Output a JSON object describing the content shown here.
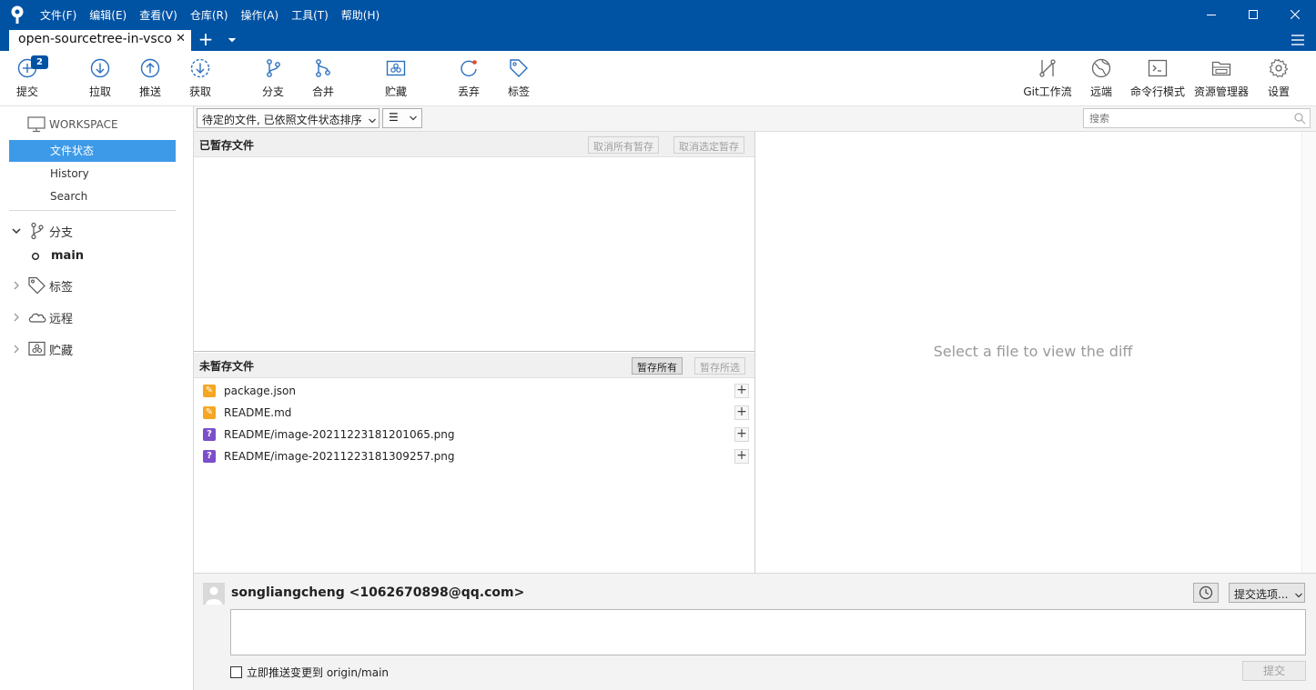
{
  "menu": [
    "文件(F)",
    "编辑(E)",
    "查看(V)",
    "仓库(R)",
    "操作(A)",
    "工具(T)",
    "帮助(H)"
  ],
  "tab": {
    "title": "open-sourcetree-in-vsco...",
    "close": "✕",
    "add": "+"
  },
  "toolbar": {
    "badge": "2",
    "commit": "提交",
    "pull": "拉取",
    "push": "推送",
    "fetch": "获取",
    "branch": "分支",
    "merge": "合并",
    "stash": "贮藏",
    "discard": "丢弃",
    "tag": "标签",
    "gitflow": "Git工作流",
    "remote": "远端",
    "terminal": "命令行模式",
    "explorer": "资源管理器",
    "settings": "设置"
  },
  "sidebar": {
    "workspace": "WORKSPACE",
    "items": [
      "文件状态",
      "History",
      "Search"
    ],
    "branches": "分支",
    "current_branch": "main",
    "tags": "标签",
    "remotes": "远程",
    "stashes": "贮藏"
  },
  "filter": {
    "sort": "待定的文件, 已依照文件状态排序",
    "view": "☰",
    "search_placeholder": "搜索"
  },
  "staged": {
    "title": "已暂存文件",
    "unstage_all": "取消所有暂存",
    "unstage_selected": "取消选定暂存"
  },
  "unstaged": {
    "title": "未暂存文件",
    "stage_all": "暂存所有",
    "stage_selected": "暂存所选",
    "files": [
      {
        "name": "package.json",
        "status": "modified"
      },
      {
        "name": "README.md",
        "status": "modified"
      },
      {
        "name": "README/image-20211223181201065.png",
        "status": "untracked"
      },
      {
        "name": "README/image-20211223181309257.png",
        "status": "untracked"
      }
    ]
  },
  "diff": {
    "placeholder": "Select a file to view the diff"
  },
  "commit": {
    "author": "songliangcheng <1062670898@qq.com>",
    "options": "提交选项...",
    "push_label": "立即推送变更到 origin/main",
    "button": "提交"
  },
  "colors": {
    "titlebar": "#0052a3",
    "accent": "#3d9ae8",
    "modified": "#f5a623",
    "untracked": "#7b4fc9"
  }
}
